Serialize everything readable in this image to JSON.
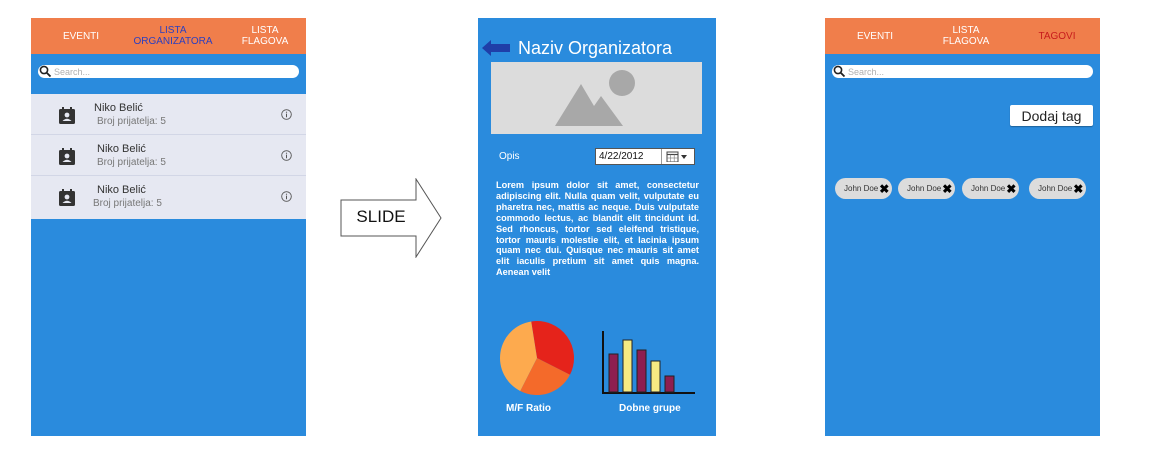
{
  "screen1": {
    "tabs": [
      {
        "label": "EVENTI"
      },
      {
        "label": "LISTA ORGANIZATORA"
      },
      {
        "label": "LISTA FLAGOVA"
      }
    ],
    "search": {
      "placeholder": "Search..."
    },
    "items": [
      {
        "name": "Niko Belić",
        "detail": "Broj prijatelja: 5"
      },
      {
        "name": "Niko Belić",
        "detail": "Broj prijatelja: 5"
      },
      {
        "name": "Niko Belić",
        "detail": "Broj prijatelja: 5"
      }
    ]
  },
  "slide_label": "SLIDE",
  "screen2": {
    "title": "Naziv Organizatora",
    "opis_label": "Opis",
    "date": "4/22/2012",
    "description": "Lorem ipsum dolor sit amet, consectetur adipiscing elit. Nulla quam velit, vulputate eu pharetra nec, mattis ac neque. Duis vulputate commodo lectus, ac blandit elit tincidunt id. Sed rhoncus, tortor sed eleifend tristique, tortor mauris molestie elit, et lacinia ipsum quam nec dui. Quisque nec mauris sit amet elit iaculis pretium sit amet quis magna. Aenean velit",
    "pie_label": "M/F Ratio",
    "bar_label": "Dobne grupe"
  },
  "screen3": {
    "tabs": [
      {
        "label": "EVENTI"
      },
      {
        "label": "LISTA FLAGOVA"
      },
      {
        "label": "TAGOVI"
      }
    ],
    "search": {
      "placeholder": "Search..."
    },
    "add_tag_label": "Dodaj tag",
    "tags": [
      {
        "label": "John Doe"
      },
      {
        "label": "John Doe"
      },
      {
        "label": "John Doe"
      },
      {
        "label": "John Doe"
      }
    ]
  },
  "colors": {
    "screen_bg": "#2A8BDD",
    "header_bg": "#F07E4B",
    "list_bg": "#E6E8F2",
    "active_tab_text": "#2B3FC0",
    "chip_bg": "#DCDCDC"
  },
  "chart_data": [
    {
      "type": "pie",
      "title": "M/F Ratio",
      "values": [
        35,
        25,
        40
      ],
      "colors": [
        "#E5231B",
        "#F46A2A",
        "#FDAA4E"
      ]
    },
    {
      "type": "bar",
      "title": "Dobne grupe",
      "values": [
        38,
        52,
        42,
        31,
        16
      ],
      "colors": [
        "#8E1E50",
        "#F6EA82",
        "#8E1E50",
        "#F6EA82",
        "#8E1E50"
      ],
      "ylim": [
        0,
        60
      ]
    }
  ]
}
